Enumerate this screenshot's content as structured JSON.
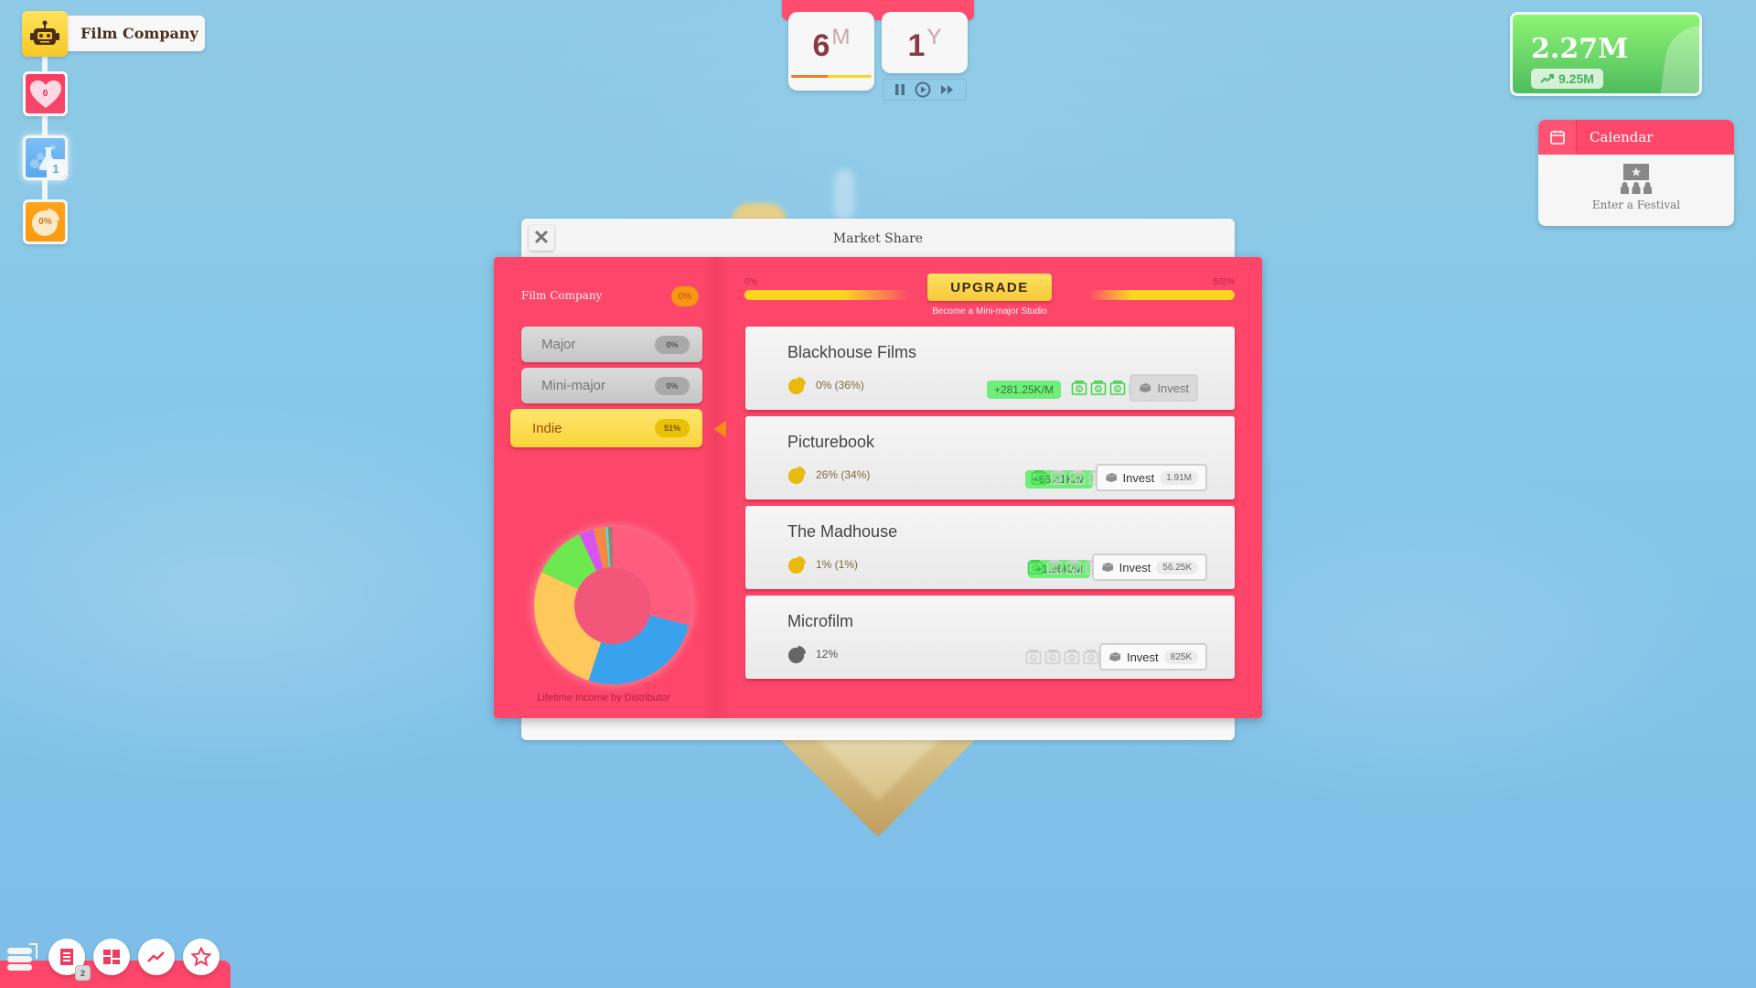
{
  "company": {
    "name": "Film Company",
    "fans": "0",
    "research_points": "1",
    "market_share": "0%"
  },
  "date": {
    "month_value": "6",
    "month_unit": "M",
    "month_progress": 0.45,
    "year_value": "1",
    "year_unit": "Y"
  },
  "money": {
    "balance": "2.27M",
    "income": "9.25M"
  },
  "calendar": {
    "title": "Calendar",
    "festival_label": "Enter a Festival"
  },
  "modal": {
    "title": "Market Share",
    "close_label": "✕",
    "own_company": "Film Company",
    "own_share": "0%",
    "tiers": [
      {
        "label": "Major",
        "percent": "0%"
      },
      {
        "label": "Mini-major",
        "percent": "0%"
      },
      {
        "label": "Indie",
        "percent": "51%",
        "selected": true
      }
    ],
    "progress": {
      "min_label": "0%",
      "max_label": "50)%",
      "upgrade_label": "UPGRADE",
      "upgrade_sub": "Become a Mini-major Studio"
    },
    "distributors": [
      {
        "name": "Blackhouse Films",
        "share": "0% (36%)",
        "rate": "+281.25K/M",
        "cash_level": 4,
        "invest_label": "Invest",
        "invest_cost": "",
        "invest_disabled": true,
        "pie_color": "#e8b90e"
      },
      {
        "name": "Picturebook",
        "share": "26% (34%)",
        "rate": "+66.41K/M",
        "cash_level": 1,
        "invest_label": "Invest",
        "invest_cost": "1.91M",
        "invest_disabled": false,
        "pie_color": "#e8b90e"
      },
      {
        "name": "The Madhouse",
        "share": "1% (1%)",
        "rate": "+1.96K/M",
        "cash_level": 1,
        "invest_label": "Invest",
        "invest_cost": "56.25K",
        "invest_disabled": false,
        "pie_color": "#e8b90e"
      },
      {
        "name": "Microfilm",
        "share": "12%",
        "rate": "",
        "cash_level": 0,
        "invest_label": "Invest",
        "invest_cost": "825K",
        "invest_disabled": false,
        "pie_color": "#666666"
      }
    ],
    "chart_caption": "Lifetime Income by Distributor"
  },
  "chart_data": {
    "type": "pie",
    "title": "Lifetime Income by Distributor",
    "donut": true,
    "slices": [
      {
        "label": "",
        "value": 29,
        "color": "#ff5c7e"
      },
      {
        "label": "",
        "value": 26,
        "color": "#38a3ec"
      },
      {
        "label": "",
        "value": 27,
        "color": "#ffc85a"
      },
      {
        "label": "",
        "value": 11,
        "color": "#6ee84f"
      },
      {
        "label": "",
        "value": 3,
        "color": "#d655f0"
      },
      {
        "label": "",
        "value": 2.5,
        "color": "#f48a42"
      },
      {
        "label": "",
        "value": 0.5,
        "color": "#4de0e0"
      },
      {
        "label": "",
        "value": 0.5,
        "color": "#7a8f6a"
      },
      {
        "label": "",
        "value": 0.5,
        "color": "#b0707a"
      }
    ]
  },
  "toolbar": {
    "items": [
      {
        "name": "news",
        "badge": "2"
      },
      {
        "name": "dashboard"
      },
      {
        "name": "statistics"
      },
      {
        "name": "favorites"
      }
    ]
  }
}
